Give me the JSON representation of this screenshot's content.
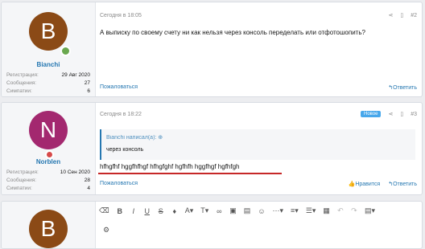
{
  "posts": [
    {
      "avatar_letter": "B",
      "username": "Bianchi",
      "date": "Сегодня в 18:05",
      "post_number": "#2",
      "stats": [
        {
          "label": "Регистрация:",
          "value": "29 Авг 2020"
        },
        {
          "label": "Сообщения:",
          "value": "27"
        },
        {
          "label": "Симпатии:",
          "value": "6"
        }
      ],
      "text": "А выписку по своему счету ни как нельзя через консоль переделать или отфотошопить?",
      "report": "Пожаловаться",
      "reply": "Ответить"
    },
    {
      "avatar_letter": "N",
      "username": "Norblen",
      "date": "Сегодня в 18:22",
      "new_badge": "Новое",
      "post_number": "#3",
      "stats": [
        {
          "label": "Регистрация:",
          "value": "10 Сен 2020"
        },
        {
          "label": "Сообщения:",
          "value": "28"
        },
        {
          "label": "Симпатии:",
          "value": "4"
        }
      ],
      "quote_author": "Bianchi написал(а):",
      "quote_text": "через консоль",
      "text": "hfhgfhf hggfhfhgf hfhgfghf hgfhfh hggfhgf hgfhfgh",
      "report": "Пожаловаться",
      "like": "Нравится",
      "reply": "Ответить"
    },
    {
      "avatar_letter": "B"
    }
  ],
  "colors": {
    "avatar_brown": "#8b4a16",
    "avatar_pink": "#a3286f",
    "online_green": "#6aa84f",
    "offline_red": "#d64a4a",
    "link_blue": "#2577b1"
  },
  "toolbar_icons": [
    "eraser-icon",
    "bold-icon",
    "italic-icon",
    "underline-icon",
    "strikethrough-icon",
    "color-icon",
    "font-size-icon",
    "font-family-icon",
    "link-icon",
    "image-icon",
    "media-icon",
    "smilie-icon",
    "more-icon",
    "align-icon",
    "list-icon",
    "table-icon",
    "undo-icon",
    "redo-icon",
    "drafts-icon",
    "settings-icon"
  ]
}
